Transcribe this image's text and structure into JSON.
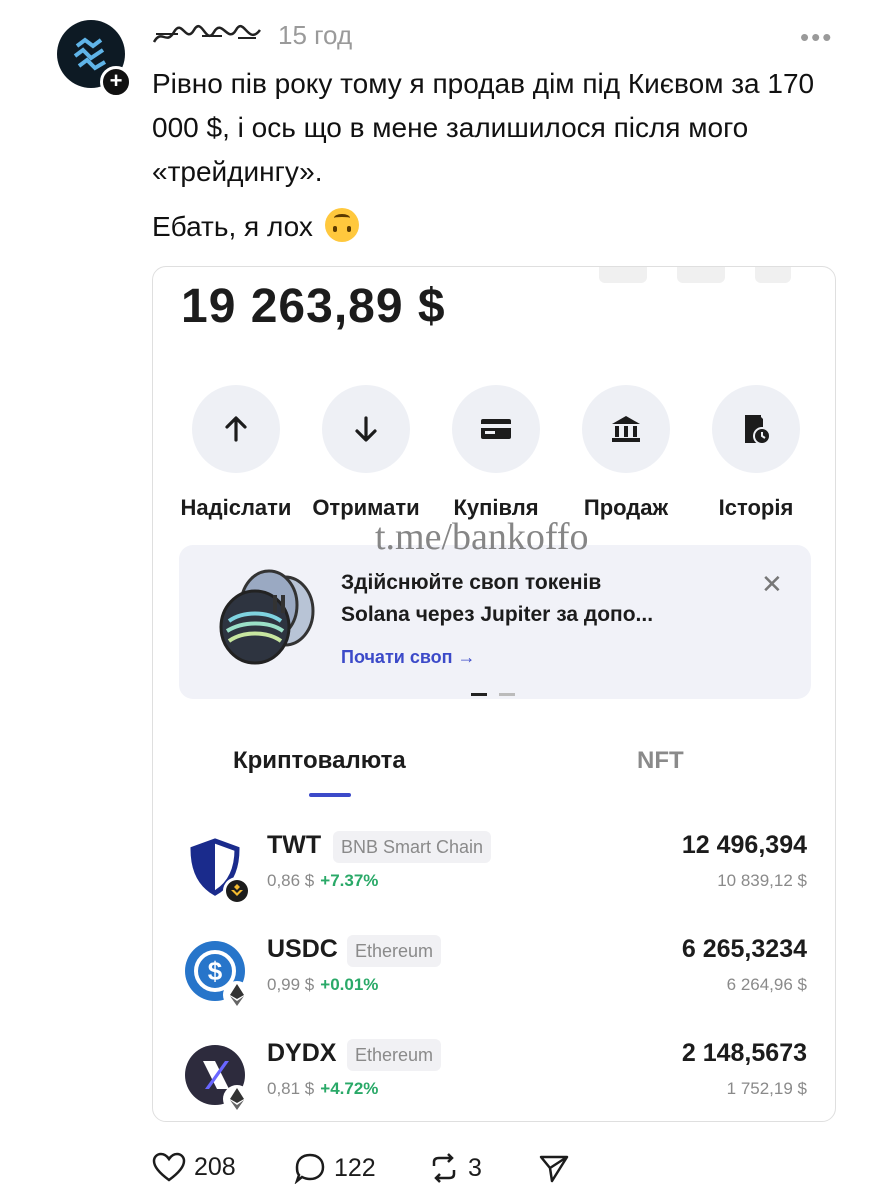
{
  "post": {
    "username_icon": "handwritten-username",
    "timestamp": "15 год",
    "more_icon": "more-dots-icon",
    "text1": "Рівно пів року тому я продав дім під Києвом за 170 000 $, і ось що в мене залишилося після мого «трейдингу».",
    "text2": "Ебать, я лох"
  },
  "wallet": {
    "balance": "19 263,89 $",
    "actions": [
      {
        "label": "Надіслати",
        "icon": "arrow-up-icon"
      },
      {
        "label": "Отримати",
        "icon": "arrow-down-icon"
      },
      {
        "label": "Купівля",
        "icon": "card-icon"
      },
      {
        "label": "Продаж",
        "icon": "bank-icon"
      },
      {
        "label": "Історія",
        "icon": "history-icon"
      }
    ],
    "watermark": "t.me/bankoffo",
    "banner": {
      "line1": "Здійснюйте своп токенів",
      "line2": "Solana через Jupiter за допо...",
      "link": "Почати своп →"
    },
    "tabs": {
      "crypto": "Криптовалюта",
      "nft": "NFT"
    },
    "tokens": [
      {
        "symbol": "TWT",
        "chain": "BNB Smart Chain",
        "price": "0,86 $",
        "change": "+7.37%",
        "amount": "12 496,394",
        "value": "10 839,12 $"
      },
      {
        "symbol": "USDC",
        "chain": "Ethereum",
        "price": "0,99 $",
        "change": "+0.01%",
        "amount": "6 265,3234",
        "value": "6 264,96 $"
      },
      {
        "symbol": "DYDX",
        "chain": "Ethereum",
        "price": "0,81 $",
        "change": "+4.72%",
        "amount": "2 148,5673",
        "value": "1 752,19 $"
      }
    ]
  },
  "engagement": {
    "likes": "208",
    "replies": "122",
    "reposts": "3"
  },
  "colors": {
    "accent": "#3c4ac9",
    "positive": "#2aa968",
    "usdc": "#2775ca"
  }
}
